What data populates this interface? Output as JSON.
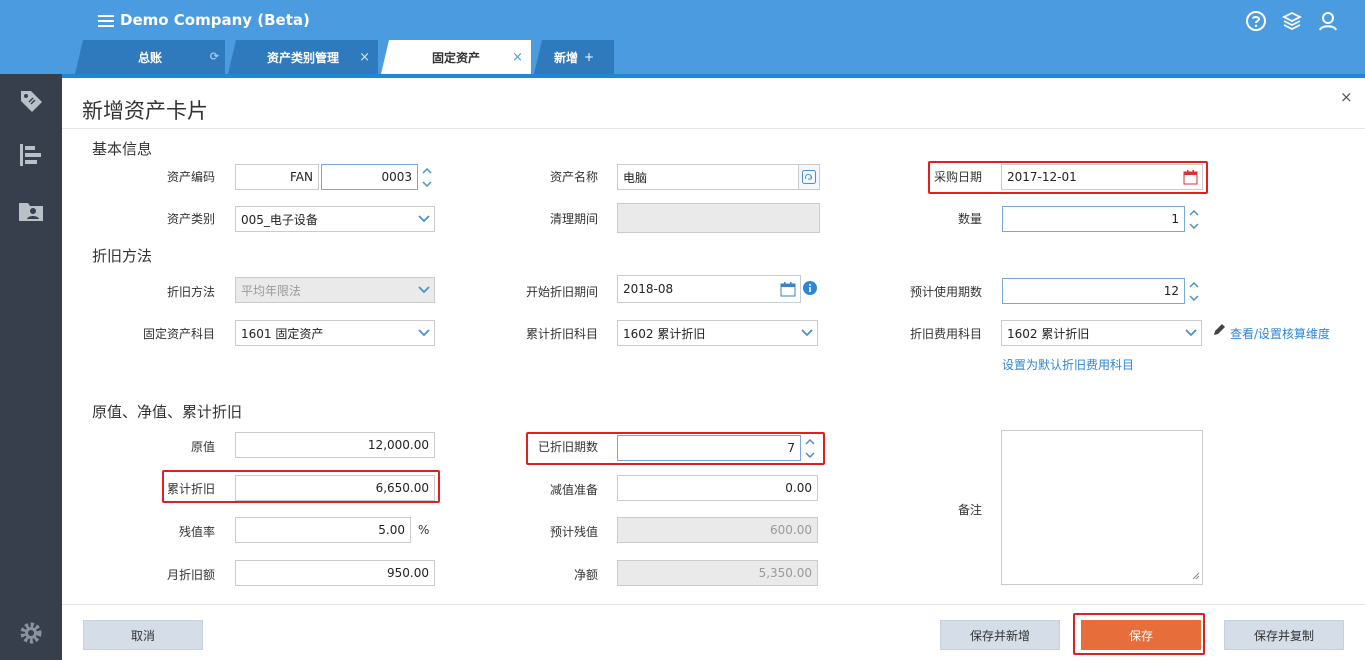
{
  "app": {
    "title": "Demo Company (Beta)"
  },
  "tabs": [
    {
      "label": "总账"
    },
    {
      "label": "资产类别管理"
    },
    {
      "label": "固定资产"
    },
    {
      "label": "新增"
    }
  ],
  "new_tab_plus": "+",
  "close_glyph": "×",
  "panel": {
    "title": "新增资产卡片"
  },
  "sections": {
    "basic": "基本信息",
    "depreciation": "折旧方法",
    "values": "原值、净值、累计折旧"
  },
  "basic": {
    "asset_code_label": "资产编码",
    "asset_code_prefix": "FAN",
    "asset_code_number": "0003",
    "asset_name_label": "资产名称",
    "asset_name_value": "电脑",
    "purchase_date_label": "采购日期",
    "purchase_date_value": "2017-12-01",
    "asset_category_label": "资产类别",
    "asset_category_value": "005_电子设备",
    "cleanup_period_label": "清理期间",
    "cleanup_period_value": "",
    "quantity_label": "数量",
    "quantity_value": "1"
  },
  "depreciation": {
    "method_label": "折旧方法",
    "method_value": "平均年限法",
    "start_period_label": "开始折旧期间",
    "start_period_value": "2018-08",
    "expected_periods_label": "预计使用期数",
    "expected_periods_value": "12",
    "fixed_asset_account_label": "固定资产科目",
    "fixed_asset_account_value": "1601 固定资产",
    "accum_account_label": "累计折旧科目",
    "accum_account_value": "1602 累计折旧",
    "expense_account_label": "折旧费用科目",
    "expense_account_value": "1602 累计折旧",
    "view_dimensions_link": "查看/设置核算维度",
    "set_default_link": "设置为默认折旧费用科目"
  },
  "values": {
    "original_label": "原值",
    "original_value": "12,000.00",
    "depreciated_periods_label": "已折旧期数",
    "depreciated_periods_value": "7",
    "accum_label": "累计折旧",
    "accum_value": "6,650.00",
    "impairment_label": "减值准备",
    "impairment_value": "0.00",
    "residual_rate_label": "残值率",
    "residual_rate_value": "5.00",
    "residual_rate_unit": "%",
    "expected_residual_label": "预计残值",
    "expected_residual_value": "600.00",
    "monthly_label": "月折旧额",
    "monthly_value": "950.00",
    "net_label": "净额",
    "net_value": "5,350.00",
    "remark_label": "备注"
  },
  "buttons": {
    "cancel": "取消",
    "save_and_new": "保存并新增",
    "save": "保存",
    "save_and_copy": "保存并复制"
  },
  "colors": {
    "header": "#4a9be0",
    "sidebar": "#363f4b",
    "primary_button": "#e76d3a",
    "highlight_box": "#e02020",
    "link": "#2e86d6"
  }
}
